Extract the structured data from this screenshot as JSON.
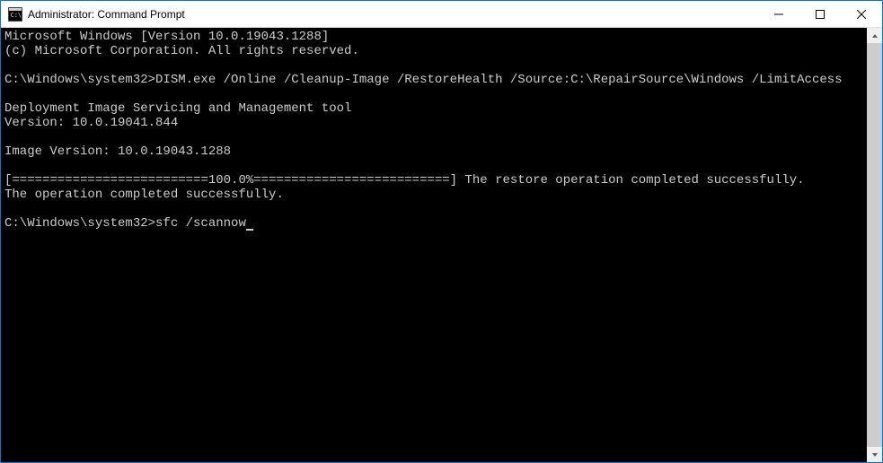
{
  "window": {
    "title": "Administrator: Command Prompt"
  },
  "terminal": {
    "lines": [
      "Microsoft Windows [Version 10.0.19043.1288]",
      "(c) Microsoft Corporation. All rights reserved.",
      "",
      "C:\\Windows\\system32>DISM.exe /Online /Cleanup-Image /RestoreHealth /Source:C:\\RepairSource\\Windows /LimitAccess",
      "",
      "Deployment Image Servicing and Management tool",
      "Version: 10.0.19041.844",
      "",
      "Image Version: 10.0.19043.1288",
      "",
      "[==========================100.0%==========================] The restore operation completed successfully.",
      "The operation completed successfully.",
      "",
      "C:\\Windows\\system32>sfc /scannow"
    ]
  }
}
